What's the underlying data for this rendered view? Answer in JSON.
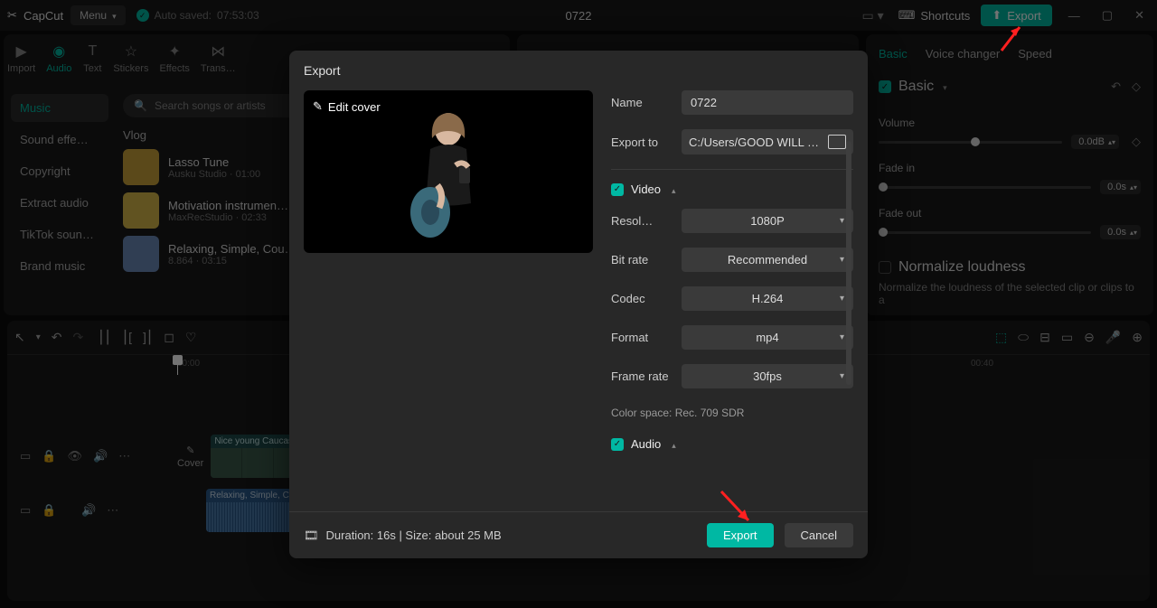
{
  "app": {
    "name": "CapCut",
    "menu": "Menu",
    "autosave_prefix": "Auto saved:",
    "autosave_time": "07:53:03",
    "project_title": "0722",
    "shortcuts": "Shortcuts",
    "export": "Export"
  },
  "lib_tabs": {
    "import": "Import",
    "audio": "Audio",
    "text": "Text",
    "stickers": "Stickers",
    "effects": "Effects",
    "transitions": "Trans…"
  },
  "lib_side": [
    "Music",
    "Sound effe…",
    "Copyright",
    "Extract audio",
    "TikTok soun…",
    "Brand music"
  ],
  "search_placeholder": "Search songs or artists",
  "lib_section": "Vlog",
  "tracks": [
    {
      "title": "Lasso Tune",
      "meta": "Ausku Studio · 01:00",
      "thumb": "#caa23a"
    },
    {
      "title": "Motivation instrumen…",
      "meta": "MaxRecStudio · 02:33",
      "thumb": "#d8b84a"
    },
    {
      "title": "Relaxing, Simple, Cou…",
      "meta": "8.864 · 03:15",
      "thumb": "#6a8ab8"
    }
  ],
  "props": {
    "tabs": {
      "basic": "Basic",
      "voice": "Voice changer",
      "speed": "Speed"
    },
    "basic_label": "Basic",
    "volume": "Volume",
    "volume_val": "0.0dB",
    "fadein": "Fade in",
    "fadein_val": "0.0s",
    "fadeout": "Fade out",
    "fadeout_val": "0.0s",
    "normalize": "Normalize loudness",
    "normalize_desc": "Normalize the loudness of the selected clip or clips to a"
  },
  "timeline": {
    "time0": "00:00",
    "time40": "00:40",
    "clip_video": "Nice young Caucasian gi",
    "clip_audio": "Relaxing, Simple, Country,",
    "cover": "Cover"
  },
  "dialog": {
    "title": "Export",
    "edit_cover": "Edit cover",
    "name_label": "Name",
    "name_value": "0722",
    "exportto_label": "Export to",
    "exportto_value": "C:/Users/GOOD WILL …",
    "video_label": "Video",
    "resol_label": "Resol…",
    "resol_value": "1080P",
    "bitrate_label": "Bit rate",
    "bitrate_value": "Recommended",
    "codec_label": "Codec",
    "codec_value": "H.264",
    "format_label": "Format",
    "format_value": "mp4",
    "framerate_label": "Frame rate",
    "framerate_value": "30fps",
    "colorspace": "Color space: Rec. 709 SDR",
    "audio_label": "Audio",
    "duration": "Duration: 16s | Size: about 25 MB",
    "btn_export": "Export",
    "btn_cancel": "Cancel"
  }
}
